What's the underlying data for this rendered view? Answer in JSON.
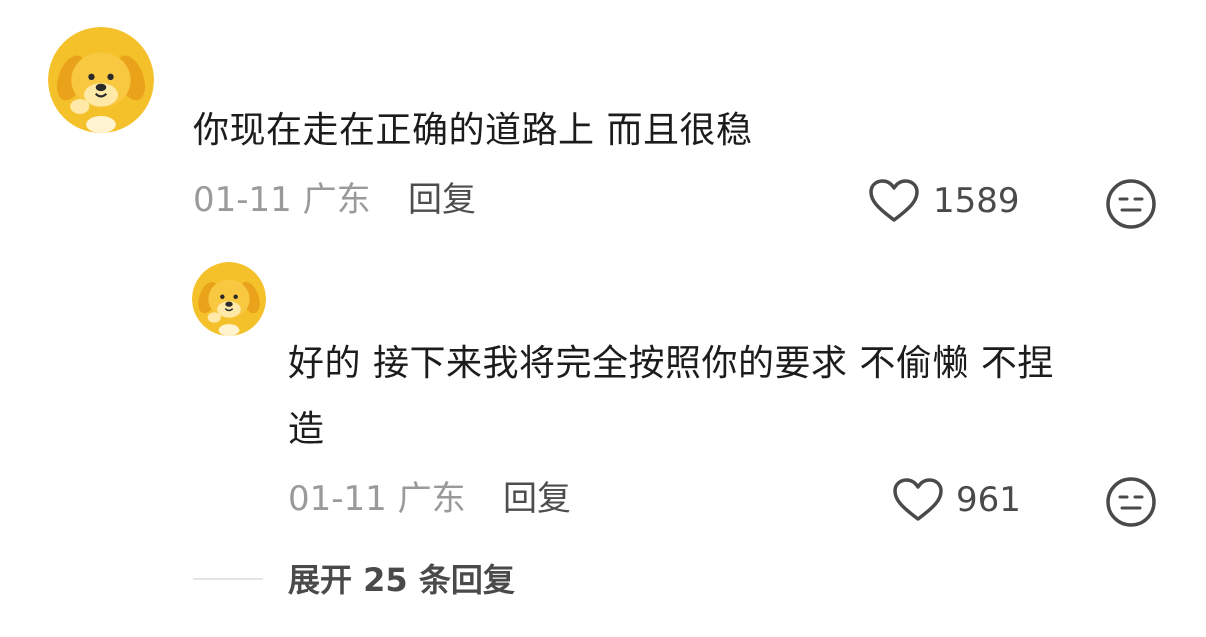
{
  "comment": {
    "text": "你现在走在正确的道路上 而且很稳",
    "date": "01-11",
    "location": "广东",
    "reply_label": "回复",
    "like_count": "1589",
    "like_icon": "heart-outline-icon",
    "dislike_icon": "meh-face-icon"
  },
  "reply": {
    "text_line1": "好的 接下来我将完全按照你的要求 不偷懒 不捏",
    "text_line2": "造",
    "date": "01-11",
    "location": "广东",
    "reply_label": "回复",
    "like_count": "961",
    "like_icon": "heart-outline-icon",
    "dislike_icon": "meh-face-icon"
  },
  "expand": {
    "label": "展开 25 条回复"
  },
  "colors": {
    "avatar_bg": "#F4C12A",
    "text": "#1C1C1C",
    "meta": "#9A9A9A"
  }
}
